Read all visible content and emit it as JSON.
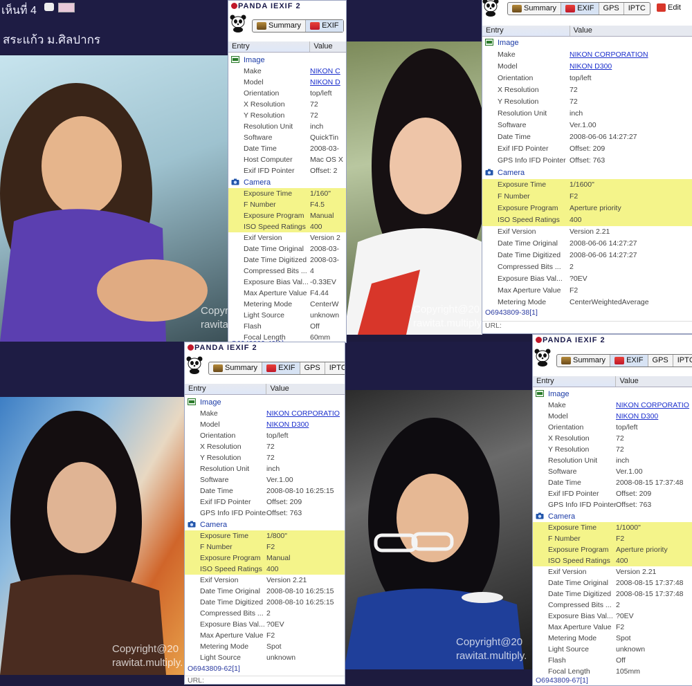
{
  "header_tl": {
    "label": "เห็นที่ 4",
    "caption": "สระแก้ว ม.ศิลปากร"
  },
  "watermark": {
    "line1": "Copyright@20",
    "line2": "rawitat.multiply."
  },
  "panel_title": "PANDA IEXIF 2",
  "tab_labels": {
    "summary": "Summary",
    "exif": "EXIF",
    "gps": "GPS",
    "iptc": "IPTC",
    "edit": "Edit"
  },
  "columns": {
    "entry": "Entry",
    "value": "Value"
  },
  "url_label": "URL:",
  "colors": {
    "highlight": "#f4f48a",
    "link": "#1a2ecc",
    "active_tab": "#d7e3f4",
    "background": "#1d1b3e"
  },
  "panels": [
    {
      "id": "panel-top-left",
      "footer": "O6943809-40[1]",
      "rows": [
        {
          "k": "Image",
          "v": "",
          "type": "section",
          "icon": "image-section-icon"
        },
        {
          "k": "Make",
          "v": "NIKON C",
          "link": true
        },
        {
          "k": "Model",
          "v": "NIKON D",
          "link": true
        },
        {
          "k": "Orientation",
          "v": "top/left"
        },
        {
          "k": "X Resolution",
          "v": "72"
        },
        {
          "k": "Y Resolution",
          "v": "72"
        },
        {
          "k": "Resolution Unit",
          "v": "inch"
        },
        {
          "k": "Software",
          "v": "QuickTin"
        },
        {
          "k": "Date Time",
          "v": "2008-03-"
        },
        {
          "k": "Host Computer",
          "v": "Mac OS X"
        },
        {
          "k": "Exif IFD Pointer",
          "v": "Offset: 2"
        },
        {
          "k": "Camera",
          "v": "",
          "type": "section",
          "icon": "camera-section-icon"
        },
        {
          "k": "Exposure Time",
          "v": "1/160\"",
          "hl": true
        },
        {
          "k": "F Number",
          "v": "F4.5",
          "hl": true
        },
        {
          "k": "Exposure Program",
          "v": "Manual",
          "hl": true
        },
        {
          "k": "ISO Speed Ratings",
          "v": "400",
          "hl": true
        },
        {
          "k": "Exif Version",
          "v": "Version 2"
        },
        {
          "k": "Date Time Original",
          "v": "2008-03-"
        },
        {
          "k": "Date Time Digitized",
          "v": "2008-03-"
        },
        {
          "k": "Compressed Bits ...",
          "v": "4"
        },
        {
          "k": "Exposure Bias Val...",
          "v": "-0.33EV"
        },
        {
          "k": "Max Aperture Value",
          "v": "F4.44"
        },
        {
          "k": "Metering Mode",
          "v": "CenterW"
        },
        {
          "k": "Light Source",
          "v": "unknown"
        },
        {
          "k": "Flash",
          "v": "Off"
        },
        {
          "k": "Focal Length",
          "v": "60mm"
        }
      ]
    },
    {
      "id": "panel-top-right",
      "footer": "O6943809-38[1]",
      "rows": [
        {
          "k": "Image",
          "v": "",
          "type": "section",
          "icon": "image-section-icon"
        },
        {
          "k": "Make",
          "v": "NIKON CORPORATION",
          "link": true
        },
        {
          "k": "Model",
          "v": "NIKON D300",
          "link": true
        },
        {
          "k": "Orientation",
          "v": "top/left"
        },
        {
          "k": "X Resolution",
          "v": "72"
        },
        {
          "k": "Y Resolution",
          "v": "72"
        },
        {
          "k": "Resolution Unit",
          "v": "inch"
        },
        {
          "k": "Software",
          "v": "Ver.1.00"
        },
        {
          "k": "Date Time",
          "v": "2008-06-06 14:27:27"
        },
        {
          "k": "Exif IFD Pointer",
          "v": "Offset: 209"
        },
        {
          "k": "GPS Info IFD Pointer",
          "v": "Offset: 763"
        },
        {
          "k": "Camera",
          "v": "",
          "type": "section",
          "icon": "camera-section-icon"
        },
        {
          "k": "Exposure Time",
          "v": "1/1600\"",
          "hl": true
        },
        {
          "k": "F Number",
          "v": "F2",
          "hl": true
        },
        {
          "k": "Exposure Program",
          "v": "Aperture priority",
          "hl": true
        },
        {
          "k": "ISO Speed Ratings",
          "v": "400",
          "hl": true
        },
        {
          "k": "Exif Version",
          "v": "Version 2.21"
        },
        {
          "k": "Date Time Original",
          "v": "2008-06-06 14:27:27"
        },
        {
          "k": "Date Time Digitized",
          "v": "2008-06-06 14:27:27"
        },
        {
          "k": "Compressed Bits ...",
          "v": "2"
        },
        {
          "k": "Exposure Bias Val...",
          "v": "?0EV"
        },
        {
          "k": "Max Aperture Value",
          "v": "F2"
        },
        {
          "k": "Metering Mode",
          "v": "CenterWeightedAverage"
        }
      ]
    },
    {
      "id": "panel-bottom-left",
      "footer": "O6943809-62[1]",
      "rows": [
        {
          "k": "Image",
          "v": "",
          "type": "section",
          "icon": "image-section-icon"
        },
        {
          "k": "Make",
          "v": "NIKON CORPORATIO",
          "link": true
        },
        {
          "k": "Model",
          "v": "NIKON D300",
          "link": true
        },
        {
          "k": "Orientation",
          "v": "top/left"
        },
        {
          "k": "X Resolution",
          "v": "72"
        },
        {
          "k": "Y Resolution",
          "v": "72"
        },
        {
          "k": "Resolution Unit",
          "v": "inch"
        },
        {
          "k": "Software",
          "v": "Ver.1.00"
        },
        {
          "k": "Date Time",
          "v": "2008-08-10 16:25:15"
        },
        {
          "k": "Exif IFD Pointer",
          "v": "Offset: 209"
        },
        {
          "k": "GPS Info IFD Pointer",
          "v": "Offset: 763"
        },
        {
          "k": "Camera",
          "v": "",
          "type": "section",
          "icon": "camera-section-icon"
        },
        {
          "k": "Exposure Time",
          "v": "1/800\"",
          "hl": true
        },
        {
          "k": "F Number",
          "v": "F2",
          "hl": true
        },
        {
          "k": "Exposure Program",
          "v": "Manual",
          "hl": true
        },
        {
          "k": "ISO Speed Ratings",
          "v": "400",
          "hl": true
        },
        {
          "k": "Exif Version",
          "v": "Version 2.21"
        },
        {
          "k": "Date Time Original",
          "v": "2008-08-10 16:25:15"
        },
        {
          "k": "Date Time Digitized",
          "v": "2008-08-10 16:25:15"
        },
        {
          "k": "Compressed Bits ...",
          "v": "2"
        },
        {
          "k": "Exposure Bias Val...",
          "v": "?0EV"
        },
        {
          "k": "Max Aperture Value",
          "v": "F2"
        },
        {
          "k": "Metering Mode",
          "v": "Spot"
        },
        {
          "k": "Light Source",
          "v": "unknown"
        }
      ]
    },
    {
      "id": "panel-bottom-right",
      "footer": "O6943809-67[1]",
      "rows": [
        {
          "k": "Image",
          "v": "",
          "type": "section",
          "icon": "image-section-icon"
        },
        {
          "k": "Make",
          "v": "NIKON CORPORATIO",
          "link": true
        },
        {
          "k": "Model",
          "v": "NIKON D300",
          "link": true
        },
        {
          "k": "Orientation",
          "v": "top/left"
        },
        {
          "k": "X Resolution",
          "v": "72"
        },
        {
          "k": "Y Resolution",
          "v": "72"
        },
        {
          "k": "Resolution Unit",
          "v": "inch"
        },
        {
          "k": "Software",
          "v": "Ver.1.00"
        },
        {
          "k": "Date Time",
          "v": "2008-08-15 17:37:48"
        },
        {
          "k": "Exif IFD Pointer",
          "v": "Offset: 209"
        },
        {
          "k": "GPS Info IFD Pointer",
          "v": "Offset: 763"
        },
        {
          "k": "Camera",
          "v": "",
          "type": "section",
          "icon": "camera-section-icon"
        },
        {
          "k": "Exposure Time",
          "v": "1/1000\"",
          "hl": true
        },
        {
          "k": "F Number",
          "v": "F2",
          "hl": true
        },
        {
          "k": "Exposure Program",
          "v": "Aperture priority",
          "hl": true
        },
        {
          "k": "ISO Speed Ratings",
          "v": "400",
          "hl": true
        },
        {
          "k": "Exif Version",
          "v": "Version 2.21"
        },
        {
          "k": "Date Time Original",
          "v": "2008-08-15 17:37:48"
        },
        {
          "k": "Date Time Digitized",
          "v": "2008-08-15 17:37:48"
        },
        {
          "k": "Compressed Bits ...",
          "v": "2"
        },
        {
          "k": "Exposure Bias Val...",
          "v": "?0EV"
        },
        {
          "k": "Max Aperture Value",
          "v": "F2"
        },
        {
          "k": "Metering Mode",
          "v": "Spot"
        },
        {
          "k": "Light Source",
          "v": "unknown"
        },
        {
          "k": "Flash",
          "v": "Off"
        },
        {
          "k": "Focal Length",
          "v": "105mm"
        }
      ]
    }
  ]
}
